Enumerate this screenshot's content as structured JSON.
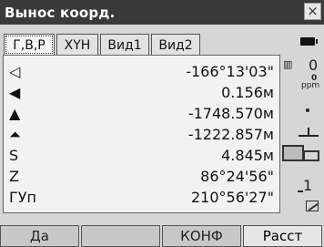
{
  "window": {
    "title": "Вынос коорд.",
    "close_label": "×"
  },
  "tabs": [
    {
      "label": "Г,В,Р",
      "active": true
    },
    {
      "label": "XYH",
      "active": false
    },
    {
      "label": "Вид1",
      "active": false
    },
    {
      "label": "Вид2",
      "active": false
    }
  ],
  "rows": [
    {
      "symbol": "◁",
      "value": "-166°13'03\""
    },
    {
      "symbol": "◀",
      "value": "0.156м"
    },
    {
      "symbol": "▲",
      "value": "-1748.570м"
    },
    {
      "symbol": "⏶",
      "value": "-1222.857м"
    },
    {
      "symbol": "S",
      "value": "4.845м"
    },
    {
      "symbol": "Z",
      "value": "86°24'56\""
    },
    {
      "symbol": "ГУп",
      "value": "210°56'27\""
    }
  ],
  "status": {
    "prism_constant": "0",
    "ppm_value": "0",
    "ppm_label": "ppm",
    "point_number": "1"
  },
  "fkeys": [
    "Да",
    "",
    "КОНФ",
    "Расст"
  ]
}
